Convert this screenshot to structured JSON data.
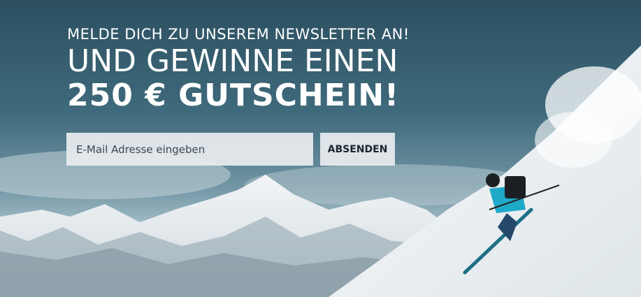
{
  "headline": {
    "line1": "MELDE DICH ZU UNSEREM NEWSLETTER AN!",
    "line2": "UND GEWINNE EINEN",
    "line3": "250 € GUTSCHEIN!"
  },
  "form": {
    "email_placeholder": "E-Mail Adresse eingeben",
    "submit_label": "ABSENDEN"
  },
  "colors": {
    "text": "#ffffff",
    "field_bg": "#e8ecef",
    "sky": "#3f6b7c",
    "jacket": "#1fa9c9"
  }
}
